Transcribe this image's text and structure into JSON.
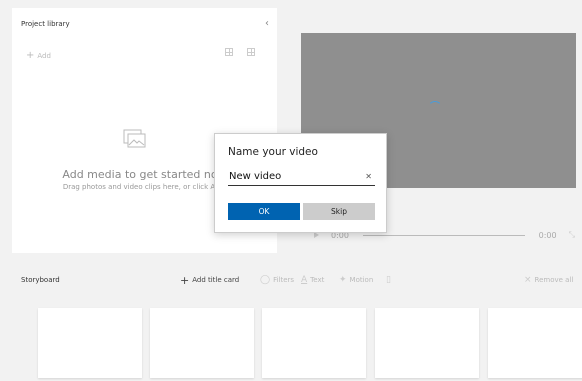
{
  "library": {
    "title": "Project library",
    "add_label": "Add",
    "empty_title": "Add media to get started now",
    "empty_subtitle": "Drag photos and video clips here, or click Add."
  },
  "preview": {
    "time_start": "0:00",
    "time_end": "0:00"
  },
  "storyboard": {
    "title": "Storyboard",
    "add_title_card": "Add title card",
    "filters": "Filters",
    "text": "Text",
    "motion": "Motion",
    "remove_all": "Remove all",
    "card_count": 5
  },
  "dialog": {
    "title": "Name your video",
    "input_value": "New video",
    "ok_label": "OK",
    "skip_label": "Skip"
  },
  "colors": {
    "accent": "#0063b1",
    "preview_bg": "#8f8f8f",
    "spinner": "#4a9bd8"
  },
  "icons": [
    "chevron-left-icon",
    "plus-icon",
    "grid-view-icon",
    "list-view-icon",
    "media-icon",
    "spinner-icon",
    "play-icon",
    "expand-icon",
    "filters-icon",
    "text-icon",
    "motion-icon",
    "trash-icon",
    "close-icon"
  ]
}
